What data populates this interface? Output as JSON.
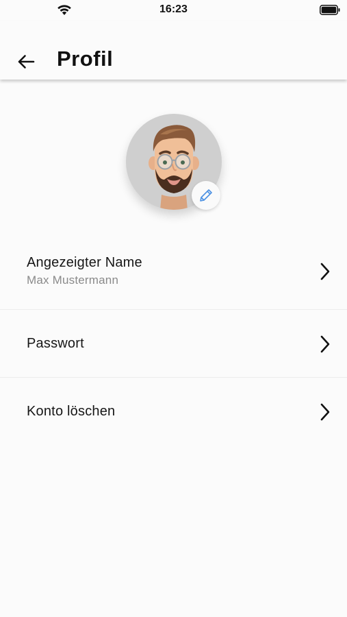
{
  "status_bar": {
    "time": "16:23",
    "wifi_icon": "wifi-icon",
    "battery_icon": "battery-full-icon"
  },
  "app_bar": {
    "back_icon": "arrow-left-icon",
    "title": "Profil"
  },
  "profile": {
    "avatar": "memoji-avatar",
    "edit_icon": "pencil-icon",
    "edit_icon_color": "#4a90e2"
  },
  "settings": {
    "items": [
      {
        "title": "Angezeigter Name",
        "subtitle": "Max Mustermann",
        "icon": "chevron-right-icon"
      },
      {
        "title": "Passwort",
        "icon": "chevron-right-icon"
      },
      {
        "title": "Konto löschen",
        "icon": "chevron-right-icon"
      }
    ]
  },
  "colors": {
    "background": "#fbfbfb",
    "avatar_bg": "#cfcfcf",
    "subtitle": "#8a8a8a"
  }
}
